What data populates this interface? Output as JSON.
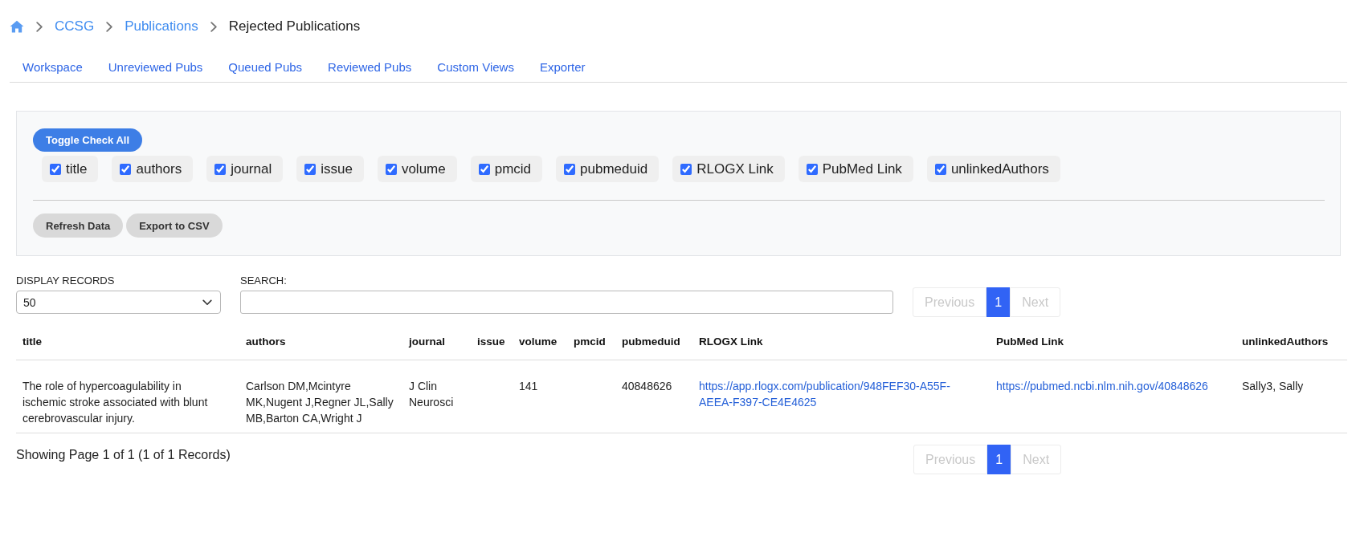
{
  "breadcrumb": {
    "items": [
      {
        "kind": "home"
      },
      {
        "kind": "link",
        "label": "CCSG"
      },
      {
        "kind": "link",
        "label": "Publications"
      },
      {
        "kind": "current",
        "label": "Rejected Publications"
      }
    ]
  },
  "tabs": [
    {
      "label": "Workspace",
      "selected": false
    },
    {
      "label": "Unreviewed Pubs",
      "selected": false
    },
    {
      "label": "Queued Pubs",
      "selected": false
    },
    {
      "label": "Reviewed Pubs",
      "selected": false
    },
    {
      "label": "Custom Views",
      "selected": false
    },
    {
      "label": "Exporter",
      "selected": false
    }
  ],
  "column_panel": {
    "toggle_all_button": "Toggle Check All",
    "columns": [
      {
        "label": "title",
        "checked": true
      },
      {
        "label": "authors",
        "checked": true
      },
      {
        "label": "journal",
        "checked": true
      },
      {
        "label": "issue",
        "checked": true
      },
      {
        "label": "volume",
        "checked": true
      },
      {
        "label": "pmcid",
        "checked": true
      },
      {
        "label": "pubmeduid",
        "checked": true
      },
      {
        "label": "RLOGX Link",
        "checked": true
      },
      {
        "label": "PubMed Link",
        "checked": true
      },
      {
        "label": "unlinkedAuthors",
        "checked": true
      }
    ],
    "buttons": [
      "Refresh Data",
      "Export to CSV"
    ]
  },
  "display_records": {
    "label": "DISPLAY RECORDS",
    "value": "50"
  },
  "search": {
    "label": "SEARCH:"
  },
  "pagination_top": {
    "previous": {
      "label": "Previous",
      "disabled": true
    },
    "pages": [
      {
        "label": "1",
        "selected": true
      }
    ],
    "next": {
      "label": "Next",
      "disabled": true
    }
  },
  "table": {
    "columns": [
      "title",
      "authors",
      "journal",
      "issue",
      "volume",
      "pmcid",
      "pubmeduid",
      "RLOGX Link",
      "PubMed Link",
      "unlinkedAuthors"
    ],
    "rows": [
      {
        "cells": [
          {
            "kind": "text",
            "text": "The role of hypercoagulability in ischemic stroke associated with blunt cerebrovascular injury."
          },
          {
            "kind": "text",
            "text": "Carlson DM,Mcintyre MK,Nugent J,Regner JL,Sally MB,Barton CA,Wright J"
          },
          {
            "kind": "text",
            "text": "J Clin Neurosci"
          },
          null,
          {
            "kind": "text",
            "text": "141"
          },
          null,
          {
            "kind": "text",
            "text": "40848626"
          },
          {
            "kind": "link",
            "text": "https://app.rlogx.com/publication/948FEF30-A55F-AEEA-F397-CE4E4625"
          },
          {
            "kind": "link",
            "text": "https://pubmed.ncbi.nlm.nih.gov/40848626"
          },
          {
            "kind": "text",
            "text": "Sally3, Sally"
          }
        ]
      }
    ]
  },
  "footer": {
    "summary": "Showing Page 1 of 1 (1 of 1 Records)"
  },
  "pagination_bottom": {
    "previous": {
      "label": "Previous",
      "disabled": true
    },
    "pages": [
      {
        "label": "1",
        "selected": true
      }
    ],
    "next": {
      "label": "Next",
      "disabled": true
    }
  }
}
